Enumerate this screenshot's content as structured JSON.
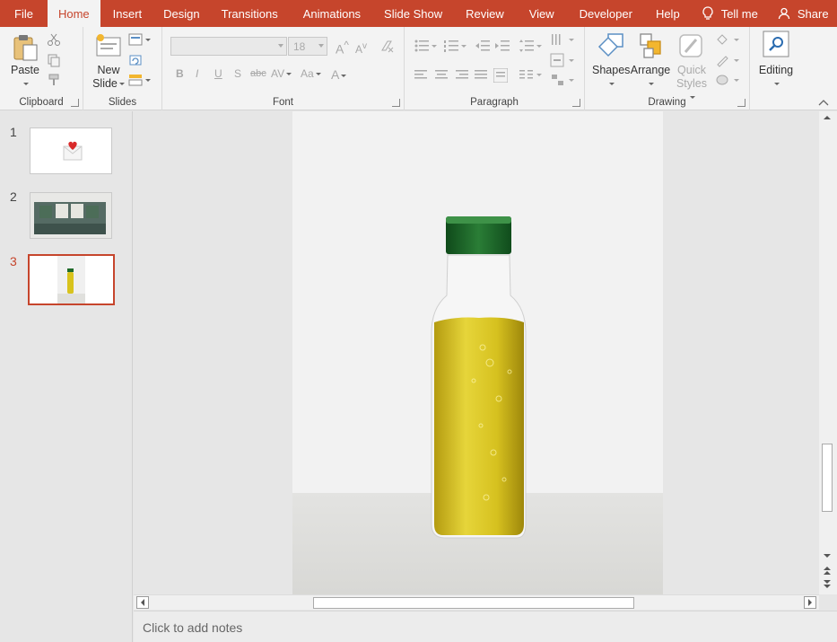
{
  "tabs": [
    {
      "label": "File",
      "active": false
    },
    {
      "label": "Home",
      "active": true
    },
    {
      "label": "Insert",
      "active": false
    },
    {
      "label": "Design",
      "active": false
    },
    {
      "label": "Transitions",
      "active": false
    },
    {
      "label": "Animations",
      "active": false
    },
    {
      "label": "Slide Show",
      "active": false
    },
    {
      "label": "Review",
      "active": false
    },
    {
      "label": "View",
      "active": false
    },
    {
      "label": "Developer",
      "active": false
    },
    {
      "label": "Help",
      "active": false
    }
  ],
  "tell_me": "Tell me",
  "share": "Share",
  "ribbon": {
    "clipboard": {
      "paste": "Paste",
      "label": "Clipboard"
    },
    "slides": {
      "new_slide_line1": "New",
      "new_slide_line2": "Slide",
      "label": "Slides"
    },
    "font": {
      "font_size": "18",
      "label": "Font",
      "bold": "B",
      "italic": "I",
      "underline": "U",
      "strike": "S",
      "strike_suffix": "abc",
      "spacing": "AV",
      "case": "Aa",
      "color_a": "A",
      "grow": "A",
      "shrink": "A"
    },
    "paragraph": {
      "label": "Paragraph"
    },
    "drawing": {
      "shapes": "Shapes",
      "arrange": "Arrange",
      "quick_styles_line1": "Quick",
      "quick_styles_line2": "Styles",
      "label": "Drawing"
    },
    "editing": {
      "label": "Editing"
    }
  },
  "slides": [
    {
      "number": "1",
      "selected": false
    },
    {
      "number": "2",
      "selected": false
    },
    {
      "number": "3",
      "selected": true
    }
  ],
  "notes_placeholder": "Click to add notes",
  "colors": {
    "accent": "#c6452c",
    "oil": "#d8c31d",
    "cap": "#1f6b2a"
  }
}
